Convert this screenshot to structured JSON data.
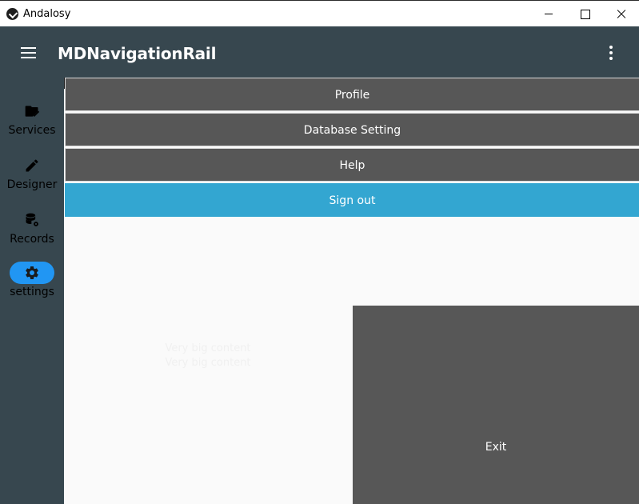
{
  "window": {
    "title": "Andalosy",
    "controls": [
      "minimize",
      "maximize",
      "close"
    ]
  },
  "appbar": {
    "title": "MDNavigationRail",
    "left_icon": "menu-icon",
    "right_icon": "dots-vertical-icon"
  },
  "rail": {
    "items": [
      {
        "label": "Services",
        "icon": "folder-edit-icon",
        "active": false
      },
      {
        "label": "Designer",
        "icon": "pencil-icon",
        "active": false
      },
      {
        "label": "Records",
        "icon": "database-cog-icon",
        "active": false
      },
      {
        "label": "settings",
        "icon": "gear-icon",
        "active": true
      }
    ]
  },
  "menu": {
    "profile": "Profile",
    "database_setting": "Database Setting",
    "help": "Help",
    "sign_out": "Sign out"
  },
  "body": {
    "big_content_lines": [
      "Very big content",
      "Very big content"
    ],
    "exit_label": "Exit"
  },
  "colors": {
    "appbar": "#37474f",
    "rail": "#37474f",
    "active_indicator": "#2196f3",
    "menu_button": "#575757",
    "sign_out": "#33a6d1",
    "content_bg": "#fafafa"
  }
}
